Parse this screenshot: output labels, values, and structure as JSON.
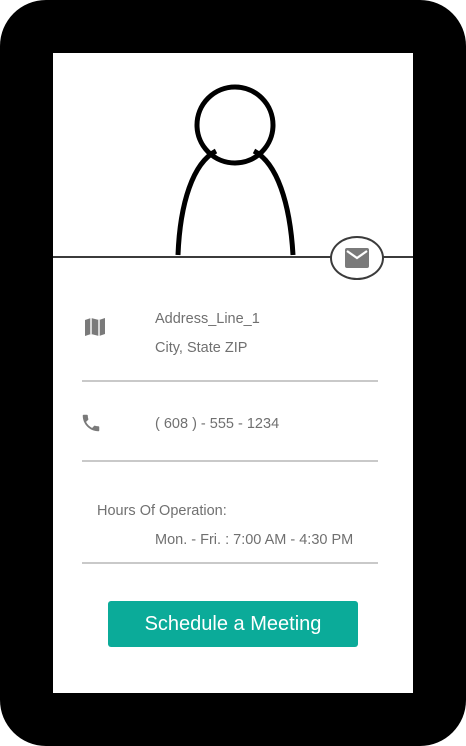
{
  "icons": {
    "avatar": "person-silhouette",
    "mail": "envelope",
    "address": "map",
    "phone": "phone"
  },
  "contact": {
    "address_line1": "Address_Line_1",
    "address_line2": "City, State ZIP",
    "phone": "( 608 ) - 555 - 1234",
    "hours_label": "Hours Of Operation:",
    "hours_value": "Mon. - Fri. : 7:00 AM - 4:30 PM"
  },
  "actions": {
    "schedule_label": "Schedule a Meeting"
  },
  "colors": {
    "accent": "#0bab99",
    "text": "#707070",
    "icon": "#7a7a7a",
    "frame": "#000000"
  }
}
